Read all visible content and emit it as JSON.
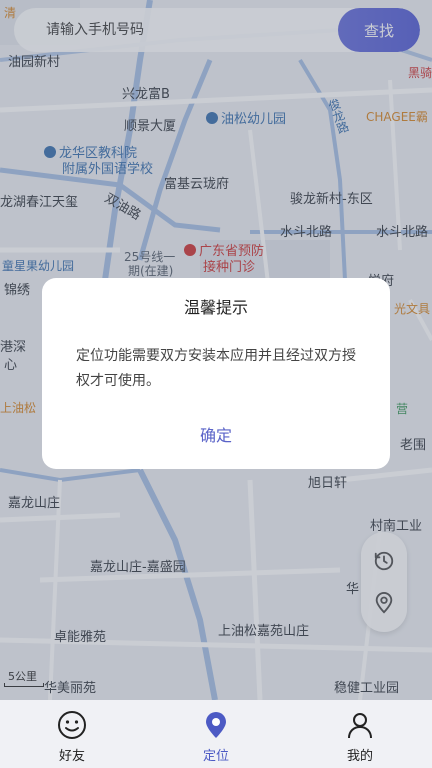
{
  "search": {
    "placeholder": "请输入手机号码",
    "button": "查找"
  },
  "map": {
    "labels": {
      "l1": "油园新村",
      "l2": "兴龙富B",
      "l3": "顺景大厦",
      "l4": "油松幼儿园",
      "l5": "俊龙路",
      "l6": "CHAGEE霸",
      "l7": "龙华区教科院",
      "l8": "附属外国语学校",
      "l9": "富基云珑府",
      "l10": "龙湖春江天玺",
      "l11": "双油路",
      "l12": "骏龙新村-东区",
      "l13": "水斗北路",
      "l14": "水斗北路",
      "l15": "25号线一",
      "l16": "期(在建)",
      "l17": "广东省预防",
      "l18": "接种门诊",
      "l19": "童星果幼儿园",
      "l20": "锦绣",
      "l21": "港深",
      "l22": "心",
      "l23": "上油松",
      "l24": "营",
      "l25": "老围",
      "l26": "旭日轩",
      "l27": "嘉龙山庄",
      "l28": "村南工业",
      "l29": "嘉龙山庄-嘉盛园",
      "l30": "华",
      "l31": "卓能雅苑",
      "l32": "上油松嘉苑山庄",
      "l33": "华美丽苑",
      "l34": "稳健工业园",
      "l35": "清",
      "l36": "黑骑",
      "l37": "光文具",
      "l38": "悦府"
    },
    "scale": "5公里"
  },
  "dialog": {
    "title": "温馨提示",
    "message": "定位功能需要双方安装本应用并且经过双方授权才可使用。",
    "confirm": "确定"
  },
  "side_controls": {
    "history_icon": "history-clock-icon",
    "locate_icon": "location-pin-icon"
  },
  "tabs": [
    {
      "label": "好友",
      "icon": "smile-face-icon"
    },
    {
      "label": "定位",
      "icon": "location-pin-icon"
    },
    {
      "label": "我的",
      "icon": "user-icon"
    }
  ],
  "colors": {
    "accent": "#5a63d6",
    "active_tab": "#4c5ac4"
  }
}
